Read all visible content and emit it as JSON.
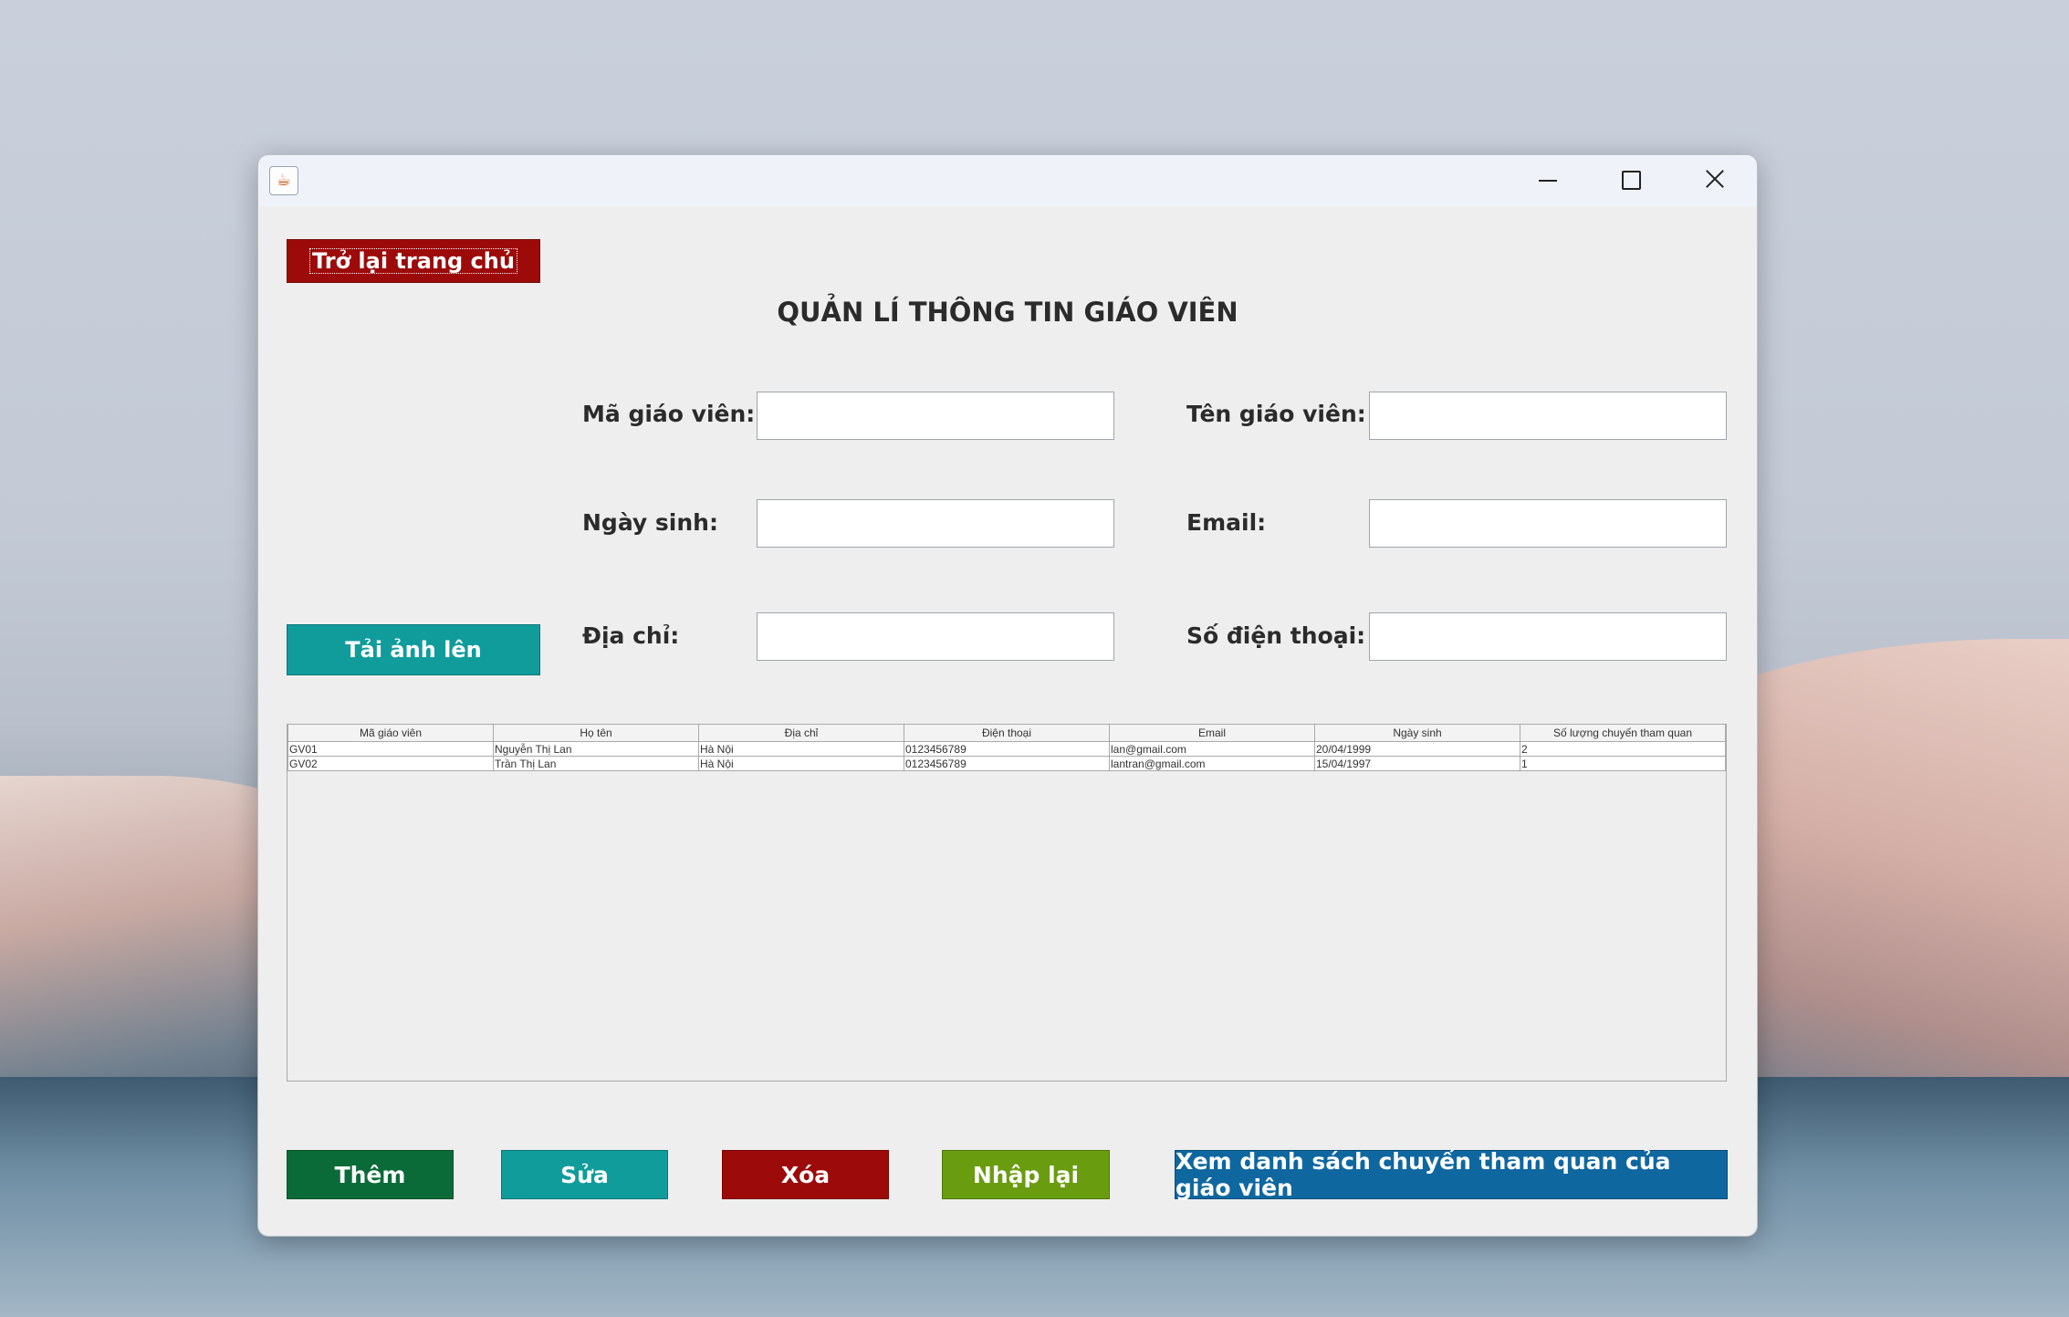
{
  "window": {
    "title": ""
  },
  "header": {
    "back_label": "Trở lại trang chủ",
    "page_title": "QUẢN LÍ THÔNG TIN GIÁO VIÊN"
  },
  "form": {
    "upload_label": "Tải ảnh lên",
    "teacher_id_label": "Mã giáo viên:",
    "teacher_id_value": "",
    "teacher_name_label": "Tên giáo viên:",
    "teacher_name_value": "",
    "dob_label": "Ngày sinh:",
    "dob_value": "",
    "email_label": "Email:",
    "email_value": "",
    "address_label": "Địa chỉ:",
    "address_value": "",
    "phone_label": "Số điện thoại:",
    "phone_value": ""
  },
  "table": {
    "columns": [
      "Mã giáo viên",
      "Họ tên",
      "Địa chỉ",
      "Điện thoại",
      "Email",
      "Ngày sinh",
      "Số lượng chuyến tham quan"
    ],
    "rows": [
      [
        "GV01",
        "Nguyễn Thị Lan",
        "Hà Nội",
        "0123456789",
        "lan@gmail.com",
        "20/04/1999",
        "2"
      ],
      [
        "GV02",
        "Trần Thị Lan",
        "Hà Nội",
        "0123456789",
        "lantran@gmail.com",
        "15/04/1997",
        "1"
      ]
    ]
  },
  "actions": {
    "add_label": "Thêm",
    "edit_label": "Sửa",
    "delete_label": "Xóa",
    "reset_label": "Nhập lại",
    "view_trips_label": "Xem danh sách chuyến tham quan của giáo viên"
  },
  "colors": {
    "back": "#9c0a0a",
    "upload": "#119c9c",
    "add": "#0b6b38",
    "edit": "#119c9c",
    "delete": "#9c0a0a",
    "reset": "#6a9c0f",
    "view": "#0f67a0"
  },
  "icons": {
    "app": "java-cup-icon",
    "minimize": "minimize-icon",
    "maximize": "maximize-icon",
    "close": "close-icon"
  }
}
